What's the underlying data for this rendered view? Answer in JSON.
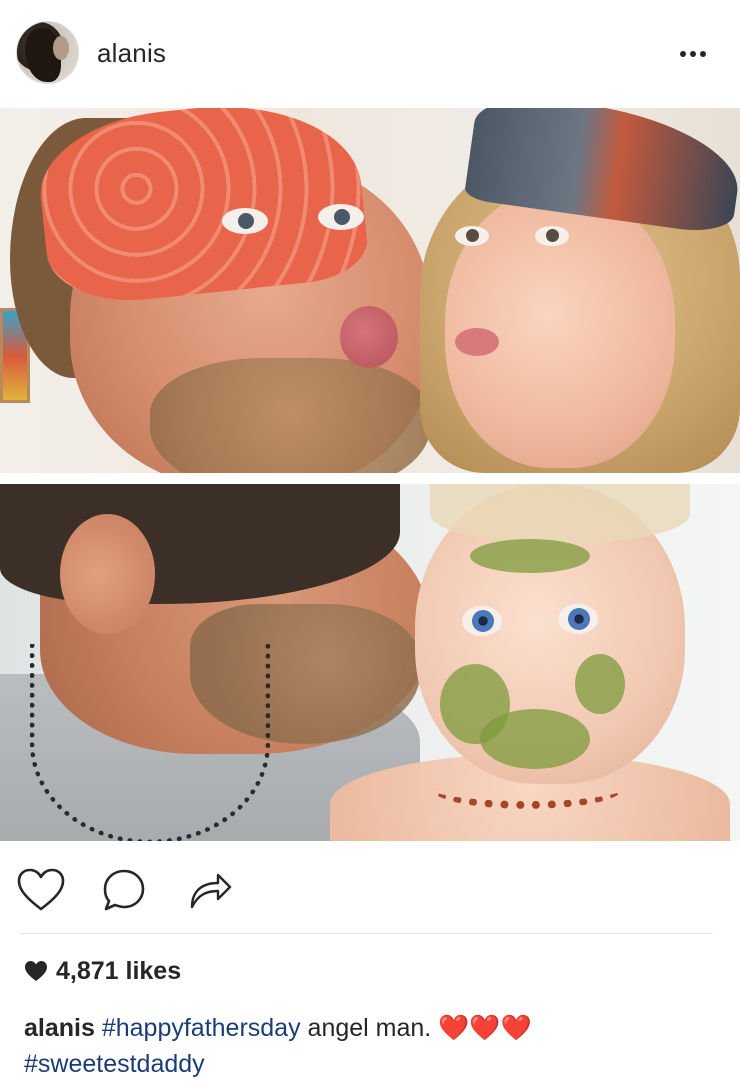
{
  "post": {
    "username": "alanis",
    "likes_text": "4,871 likes",
    "caption": {
      "username": "alanis",
      "hashtag1": "#happyfathersday",
      "text": "angel man.",
      "emoji": "❤️❤️❤️",
      "hashtag2": "#sweetestdaddy"
    }
  },
  "icons": {
    "more": "more-options-icon",
    "like": "heart-outline-icon",
    "comment": "comment-bubble-icon",
    "share": "share-arrow-icon",
    "likes": "heart-filled-icon"
  },
  "colors": {
    "text": "#262626",
    "hashtag": "#1b3d77",
    "heart_emoji": "#d81d1d"
  }
}
